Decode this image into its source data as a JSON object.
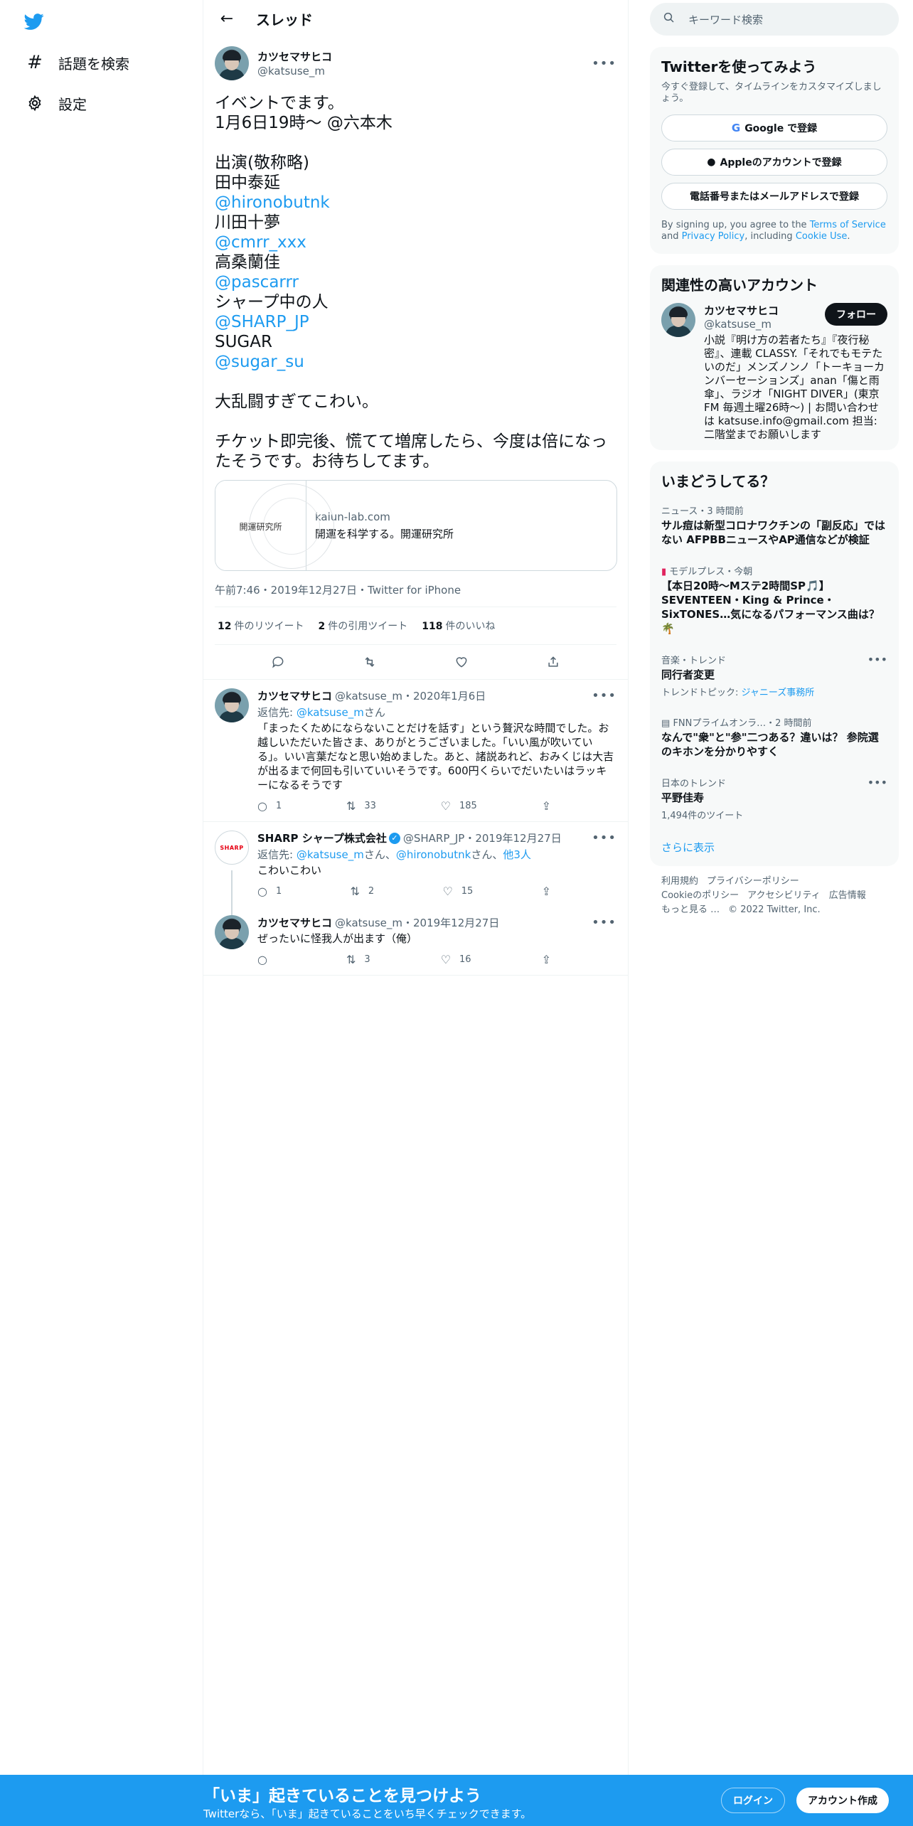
{
  "nav": {
    "explore_label": "話題を検索",
    "settings_label": "設定"
  },
  "header": {
    "title": "スレッド"
  },
  "main_tweet": {
    "display_name": "カツセマサヒコ",
    "username": "@katsuse_m",
    "lines": [
      {
        "text": "イベントでます。",
        "link": false
      },
      {
        "text": "1月6日19時〜 @六本木",
        "link": false
      },
      {
        "text": "",
        "link": false
      },
      {
        "text": "出演(敬称略)",
        "link": false
      },
      {
        "text": "田中泰延",
        "link": false
      },
      {
        "text": "@hironobutnk",
        "link": true
      },
      {
        "text": "川田十夢",
        "link": false
      },
      {
        "text": "@cmrr_xxx",
        "link": true
      },
      {
        "text": "高桑蘭佳",
        "link": false
      },
      {
        "text": "@pascarrr",
        "link": true
      },
      {
        "text": "シャープ中の人",
        "link": false
      },
      {
        "text": "@SHARP_JP",
        "link": true
      },
      {
        "text": "SUGAR",
        "link": false
      },
      {
        "text": "@sugar_su",
        "link": true
      },
      {
        "text": "",
        "link": false
      },
      {
        "text": "大乱闘すぎてこわい。",
        "link": false
      },
      {
        "text": "",
        "link": false
      },
      {
        "text": "チケット即完後、慌てて増席したら、今度は倍になったそうです。お待ちしてます。",
        "link": false
      }
    ],
    "card": {
      "image_text": "開運研究所",
      "domain": "kaiun-lab.com",
      "title": "開運を科学する。開運研究所"
    },
    "meta": "午前7:46・2019年12月27日・Twitter for iPhone",
    "stats": {
      "retweets": "12",
      "retweets_label": "件のリツイート",
      "quotes": "2",
      "quotes_label": "件の引用ツイート",
      "likes": "118",
      "likes_label": "件のいいね"
    }
  },
  "replies": [
    {
      "display_name": "カツセマサヒコ",
      "meta": "@katsuse_m・2020年1月6日",
      "replying_prefix": "返信先: ",
      "replying_to": "@katsuse_m",
      "replying_suffix": "さん",
      "text": "「まったくためにならないことだけを話す」という贅沢な時間でした。お越しいただいた皆さま、ありがとうございました。「いい風が吹いている」。いい言葉だなと思い始めました。あと、諸説あれど、おみくじは大吉が出るまで何回も引いていいそうです。600円くらいでだいたいはラッキーになるそうです",
      "reply_count": "1",
      "retweet_count": "33",
      "like_count": "185"
    },
    {
      "display_name": "SHARP シャープ株式会社",
      "avatar_text": "SHARP",
      "meta": "@SHARP_JP・2019年12月27日",
      "replying_prefix": "返信先: ",
      "replying_to_1": "@katsuse_m",
      "replying_mid": "さん、",
      "replying_to_2": "@hironobutnk",
      "replying_mid2": "さん、",
      "replying_others": "他3人",
      "text": "こわいこわい",
      "reply_count": "1",
      "retweet_count": "2",
      "like_count": "15"
    },
    {
      "display_name": "カツセマサヒコ",
      "meta": "@katsuse_m・2019年12月27日",
      "text": "ぜったいに怪我人が出ます（俺）",
      "reply_count": "",
      "retweet_count": "3",
      "like_count": "16"
    }
  ],
  "search": {
    "placeholder": "キーワード検索"
  },
  "signup_panel": {
    "title": "Twitterを使ってみよう",
    "desc": "今すぐ登録して、タイムラインをカスタマイズしましょう。",
    "google": "Google で登録",
    "apple": "Appleのアカウントで登録",
    "phone": "電話番号またはメールアドレスで登録",
    "terms_1": "By signing up, you agree to the ",
    "terms_tos": "Terms of Service",
    "terms_2": " and ",
    "terms_pp": "Privacy Policy",
    "terms_3": ", including ",
    "terms_cookie": "Cookie Use",
    "terms_4": "."
  },
  "related": {
    "title": "関連性の高いアカウント",
    "display_name": "カツセマサヒコ",
    "username": "@katsuse_m",
    "follow": "フォロー",
    "bio": "小説『明け方の若者たち』『夜行秘密』、連載 CLASSY.「それでもモテたいのだ」メンズノンノ「トーキョーカンバーセーションズ」anan「傷と雨傘」、ラジオ「NIGHT DIVER」(東京FM 毎週土曜26時〜) | お問い合わせは katsuse.info@gmail.com 担当: 二階堂までお願いします"
  },
  "trends": {
    "title": "いまどうしてる？",
    "items": [
      {
        "category": "ニュース・3 時間前",
        "title": "サル痘は新型コロナワクチンの「副反応」ではない AFPBBニュースやAP通信などが検証",
        "sub": "",
        "more": false
      },
      {
        "category": "モデルプレス・今朝",
        "title": "【本日20時～Mステ2時間SP🎵】SEVENTEEN・King & Prince・SixTONES…気になるパフォーマンス曲は？🌴",
        "sub": "",
        "more": false
      },
      {
        "category": "音楽・トレンド",
        "title": "同行者変更",
        "sub_prefix": "トレンドトピック: ",
        "sub_link": "ジャニーズ事務所",
        "more": true
      },
      {
        "category": "FNNプライムオンラ…・2 時間前",
        "title": "なんで\"衆\"と\"参\"二つある？違いは？ 参院選のキホンを分かりやすく",
        "sub": "",
        "more": false
      },
      {
        "category": "日本のトレンド",
        "title": "平野佳寿",
        "sub": "1,494件のツイート",
        "more": true
      }
    ],
    "show_more": "さらに表示"
  },
  "footer": {
    "links": [
      "利用規約",
      "プライバシーポリシー",
      "Cookieのポリシー",
      "アクセシビリティ",
      "広告情報",
      "もっと見る …",
      "© 2022 Twitter, Inc."
    ]
  },
  "bottom_bar": {
    "headline": "「いま」起きていることを見つけよう",
    "sub": "Twitterなら、「いま」起きていることをいち早くチェックできます。",
    "login": "ログイン",
    "signup": "アカウント作成"
  }
}
